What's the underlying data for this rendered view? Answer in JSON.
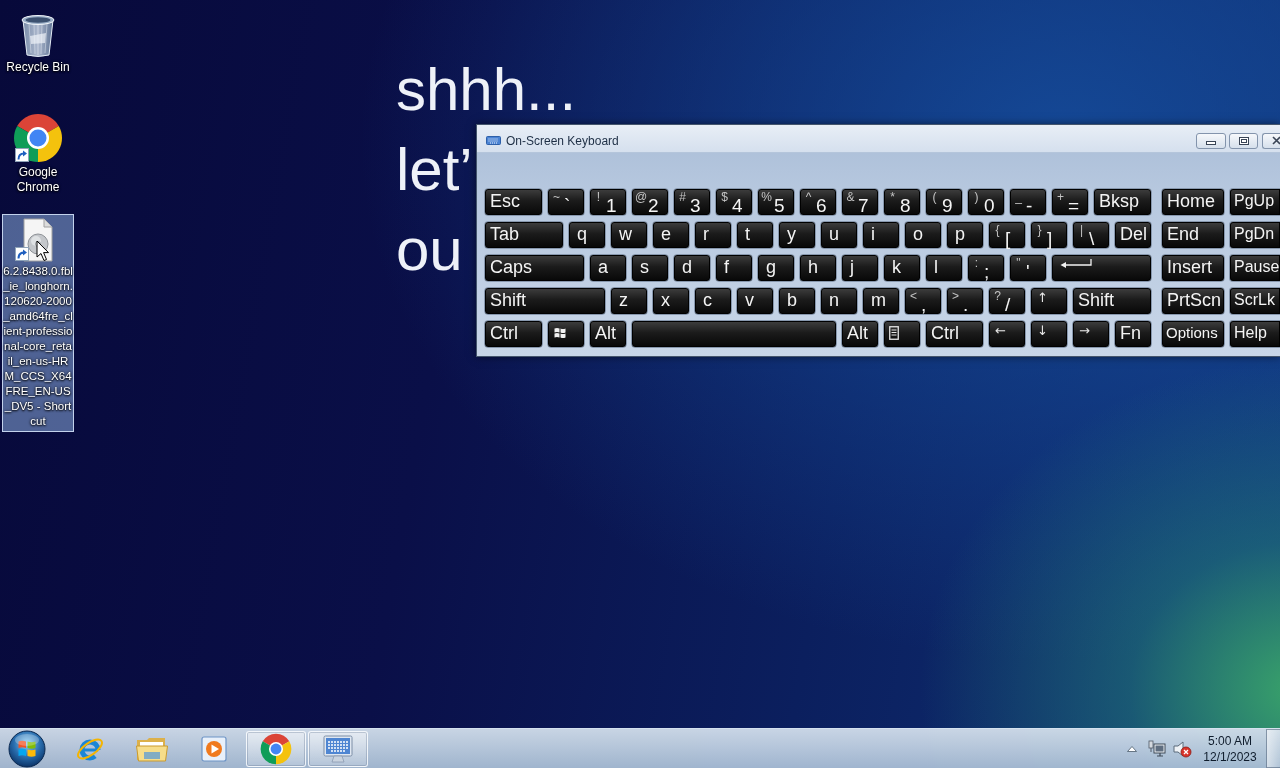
{
  "desktop_icons": [
    {
      "kind": "bin",
      "label": "Recycle Bin",
      "selected": false,
      "shortcut": false
    },
    {
      "kind": "chrome",
      "label": "Google Chrome",
      "selected": false,
      "shortcut": true
    },
    {
      "kind": "file",
      "label": "6.2.8438.0.fbl_ie_longhorn.120620-2000_amd64fre_client-professional-core_retail_en-us-HRM_CCS_X64FRE_EN-US_DV5 - Shortcut",
      "selected": true,
      "shortcut": true
    }
  ],
  "background_text": [
    "shhh...",
    "let’",
    "ou"
  ],
  "keyboard_window": {
    "title": "On-Screen Keyboard",
    "main_rows": [
      [
        {
          "kind": "text",
          "label": "Esc"
        },
        {
          "kind": "dual",
          "shift": "~",
          "label": "`"
        },
        {
          "kind": "dual",
          "shift": "!",
          "label": "1"
        },
        {
          "kind": "dual",
          "shift": "@",
          "label": "2"
        },
        {
          "kind": "dual",
          "shift": "#",
          "label": "3"
        },
        {
          "kind": "dual",
          "shift": "$",
          "label": "4"
        },
        {
          "kind": "dual",
          "shift": "%",
          "label": "5"
        },
        {
          "kind": "dual",
          "shift": "^",
          "label": "6"
        },
        {
          "kind": "dual",
          "shift": "&",
          "label": "7"
        },
        {
          "kind": "dual",
          "shift": "*",
          "label": "8"
        },
        {
          "kind": "dual",
          "shift": "(",
          "label": "9"
        },
        {
          "kind": "dual",
          "shift": ")",
          "label": "0"
        },
        {
          "kind": "dual",
          "shift": "_",
          "label": "-"
        },
        {
          "kind": "dual",
          "shift": "+",
          "label": "="
        },
        {
          "kind": "text",
          "label": "Bksp"
        }
      ],
      [
        {
          "kind": "text",
          "label": "Tab"
        },
        {
          "kind": "letter",
          "label": "q"
        },
        {
          "kind": "letter",
          "label": "w"
        },
        {
          "kind": "letter",
          "label": "e"
        },
        {
          "kind": "letter",
          "label": "r"
        },
        {
          "kind": "letter",
          "label": "t"
        },
        {
          "kind": "letter",
          "label": "y"
        },
        {
          "kind": "letter",
          "label": "u"
        },
        {
          "kind": "letter",
          "label": "i"
        },
        {
          "kind": "letter",
          "label": "o"
        },
        {
          "kind": "letter",
          "label": "p"
        },
        {
          "kind": "dual",
          "shift": "{",
          "label": "["
        },
        {
          "kind": "dual",
          "shift": "}",
          "label": "]"
        },
        {
          "kind": "dual",
          "shift": "|",
          "label": "\\"
        },
        {
          "kind": "text",
          "label": "Del"
        }
      ],
      [
        {
          "kind": "text",
          "label": "Caps"
        },
        {
          "kind": "letter",
          "label": "a"
        },
        {
          "kind": "letter",
          "label": "s"
        },
        {
          "kind": "letter",
          "label": "d"
        },
        {
          "kind": "letter",
          "label": "f"
        },
        {
          "kind": "letter",
          "label": "g"
        },
        {
          "kind": "letter",
          "label": "h"
        },
        {
          "kind": "letter",
          "label": "j"
        },
        {
          "kind": "letter",
          "label": "k"
        },
        {
          "kind": "letter",
          "label": "l"
        },
        {
          "kind": "dual",
          "shift": ":",
          "label": ";"
        },
        {
          "kind": "dual",
          "shift": "\"",
          "label": "'"
        },
        {
          "kind": "enter"
        }
      ],
      [
        {
          "kind": "text",
          "label": "Shift"
        },
        {
          "kind": "letter",
          "label": "z"
        },
        {
          "kind": "letter",
          "label": "x"
        },
        {
          "kind": "letter",
          "label": "c"
        },
        {
          "kind": "letter",
          "label": "v"
        },
        {
          "kind": "letter",
          "label": "b"
        },
        {
          "kind": "letter",
          "label": "n"
        },
        {
          "kind": "letter",
          "label": "m"
        },
        {
          "kind": "dual",
          "shift": "<",
          "label": ","
        },
        {
          "kind": "dual",
          "shift": ">",
          "label": "."
        },
        {
          "kind": "dual",
          "shift": "?",
          "label": "/"
        },
        {
          "kind": "arrow",
          "label": "↑"
        },
        {
          "kind": "text",
          "label": "Shift"
        }
      ],
      [
        {
          "kind": "text",
          "label": "Ctrl"
        },
        {
          "kind": "windows"
        },
        {
          "kind": "text",
          "label": "Alt"
        },
        {
          "kind": "space"
        },
        {
          "kind": "text",
          "label": "Alt"
        },
        {
          "kind": "menu"
        },
        {
          "kind": "text",
          "label": "Ctrl"
        },
        {
          "kind": "arrow",
          "label": "←"
        },
        {
          "kind": "arrow",
          "label": "↓"
        },
        {
          "kind": "arrow",
          "label": "→"
        },
        {
          "kind": "text",
          "label": "Fn"
        }
      ]
    ],
    "nav_rows": [
      [
        {
          "kind": "text",
          "label": "Home"
        },
        {
          "kind": "text",
          "label": "PgUp"
        }
      ],
      [
        {
          "kind": "text",
          "label": "End"
        },
        {
          "kind": "text",
          "label": "PgDn"
        }
      ],
      [
        {
          "kind": "text",
          "label": "Insert"
        },
        {
          "kind": "text",
          "label": "Pause"
        }
      ],
      [
        {
          "kind": "text",
          "label": "PrtScn"
        },
        {
          "kind": "text",
          "label": "ScrLk"
        }
      ],
      [
        {
          "kind": "small",
          "label": "Options"
        },
        {
          "kind": "text",
          "label": "Help"
        }
      ]
    ]
  },
  "taskbar": {
    "items": [
      {
        "kind": "ie",
        "running": false
      },
      {
        "kind": "explorer",
        "running": false
      },
      {
        "kind": "media",
        "running": false
      },
      {
        "kind": "chrome",
        "running": true
      },
      {
        "kind": "keyboard",
        "running": true
      }
    ],
    "tray": {
      "volume_muted": true,
      "time": "5:00 AM",
      "date": "12/1/2023"
    }
  }
}
